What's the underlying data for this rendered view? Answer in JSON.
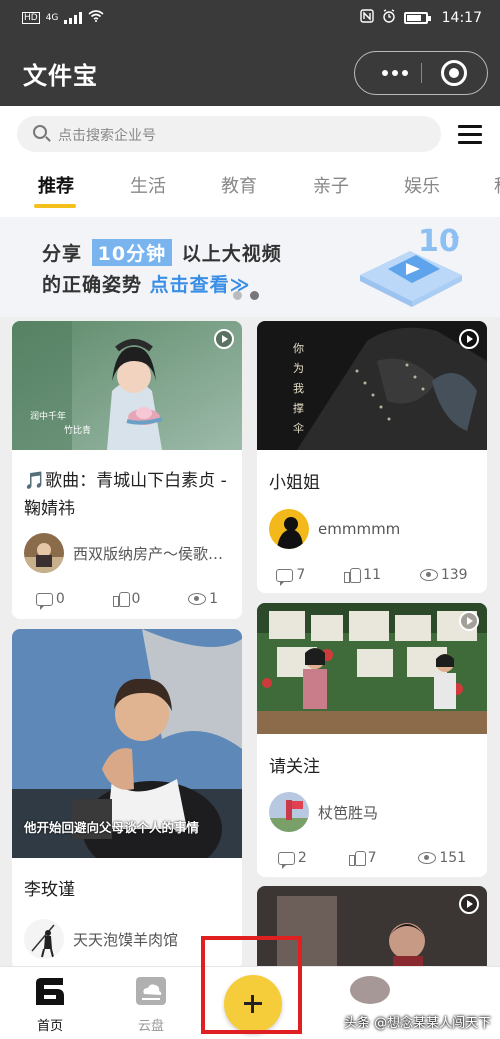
{
  "status_bar": {
    "network_left": "HD",
    "network_type": "4G",
    "time": "14:17"
  },
  "app": {
    "title": "文件宝"
  },
  "search": {
    "placeholder": "点击搜索企业号"
  },
  "tabs": [
    {
      "label": "推荐",
      "active": true
    },
    {
      "label": "生活",
      "active": false
    },
    {
      "label": "教育",
      "active": false
    },
    {
      "label": "亲子",
      "active": false
    },
    {
      "label": "娱乐",
      "active": false
    },
    {
      "label": "科",
      "active": false
    }
  ],
  "banner": {
    "line1_pre": "分享",
    "line1_highlight": "10分钟",
    "line1_post": "以上大视频",
    "line2_pre": "的正确姿势",
    "line2_link": "点击查看≫",
    "dots": 2,
    "active_dot": 1
  },
  "feed": {
    "left": [
      {
        "title": "🎵歌曲：青城山下白素贞 - 鞠婧祎",
        "author": "西双版纳房产～侯歌…",
        "comments": "0",
        "likes": "0",
        "views": "1",
        "thumb_text": [
          "润中千年",
          "竹比青"
        ]
      },
      {
        "title": "李玫谨",
        "author": "天天泡馍羊肉馆",
        "subtitle": "他开始回避向父母谈个人的事情"
      }
    ],
    "right": [
      {
        "title": "小姐姐",
        "author": "emmmmm",
        "comments": "7",
        "likes": "11",
        "views": "139",
        "thumb_text": "你 为 我 撑 伞"
      },
      {
        "title": "请关注",
        "author": "杖笆胜马",
        "comments": "2",
        "likes": "7",
        "views": "151"
      }
    ]
  },
  "bottom_tabs": [
    {
      "label": "首页",
      "active": true
    },
    {
      "label": "云盘",
      "active": false
    }
  ],
  "watermark": "头条 @想念某某人闯天下",
  "colors": {
    "accent": "#f3c01c",
    "fab": "#f5cd3a",
    "nav_bg": "#3a3a3a",
    "annotation": "#e02020"
  }
}
